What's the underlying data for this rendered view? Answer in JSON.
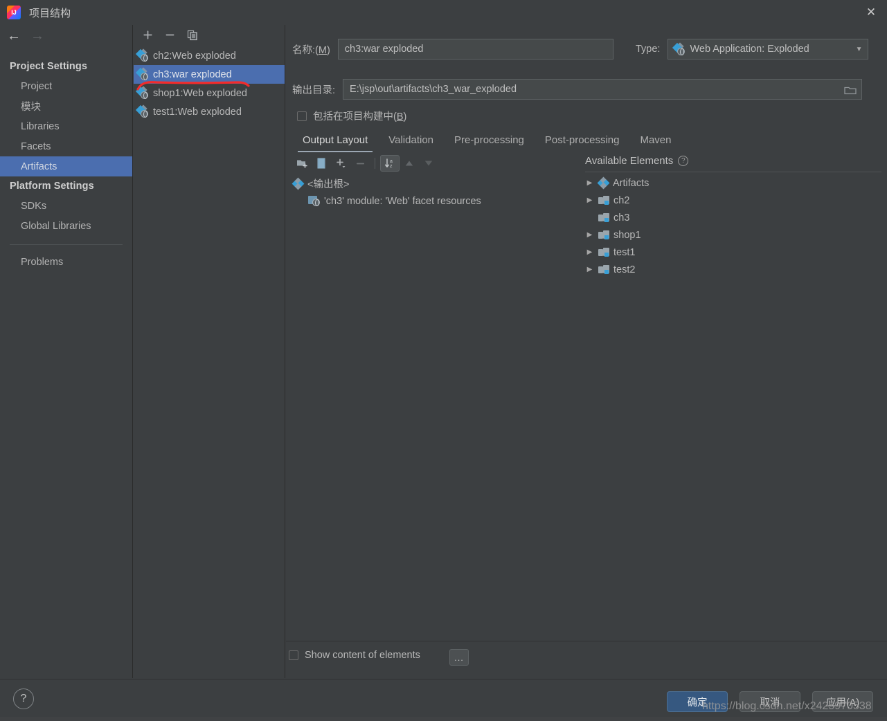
{
  "window": {
    "title": "项目结构",
    "app_icon": "intellij-idea-icon",
    "close_label": "✕"
  },
  "sidebar": {
    "back_label": "←",
    "forward_label": "→",
    "groups": [
      {
        "label": "Project Settings",
        "items": [
          {
            "label": "Project",
            "selected": false
          },
          {
            "label": "模块",
            "selected": false
          },
          {
            "label": "Libraries",
            "selected": false
          },
          {
            "label": "Facets",
            "selected": false
          },
          {
            "label": "Artifacts",
            "selected": true
          }
        ]
      },
      {
        "label": "Platform Settings",
        "items": [
          {
            "label": "SDKs",
            "selected": false
          },
          {
            "label": "Global Libraries",
            "selected": false
          }
        ]
      }
    ],
    "problems_label": "Problems"
  },
  "artifacts_panel": {
    "toolbar": [
      {
        "name": "add-artifact-button",
        "glyph": "+"
      },
      {
        "name": "remove-artifact-button",
        "glyph": "−"
      },
      {
        "name": "copy-artifact-button",
        "glyph": "copy-icon"
      }
    ],
    "items": [
      {
        "label": "ch2:Web exploded",
        "selected": false
      },
      {
        "label": "ch3:war exploded",
        "selected": true
      },
      {
        "label": "shop1:Web exploded",
        "selected": false
      },
      {
        "label": "test1:Web exploded",
        "selected": false
      }
    ]
  },
  "annotation": {
    "color": "#F42B2B",
    "type": "hand-drawn-underline"
  },
  "form": {
    "name_label": "名称:(M)",
    "name_mnemonic": "M",
    "name_value": "ch3:war exploded",
    "type_label": "Type:",
    "type_value": "Web Application: Exploded",
    "output_dir_label": "输出目录:",
    "output_dir_value": "E:\\jsp\\out\\artifacts\\ch3_war_exploded",
    "include_in_build_label": "包括在项目构建中(B)",
    "include_in_build_mnemonic": "B",
    "include_in_build_checked": false
  },
  "tabs": [
    {
      "label": "Output Layout",
      "active": true
    },
    {
      "label": "Validation",
      "active": false
    },
    {
      "label": "Pre-processing",
      "active": false
    },
    {
      "label": "Post-processing",
      "active": false
    },
    {
      "label": "Maven",
      "active": false
    }
  ],
  "layout_toolbar": [
    {
      "name": "create-directory-button",
      "icon": "folder-add-icon",
      "pressed": false,
      "enabled": true
    },
    {
      "name": "create-archive-button",
      "icon": "archive-icon",
      "pressed": false,
      "enabled": true
    },
    {
      "name": "add-copy-of-button",
      "icon": "plus-dropdown-icon",
      "pressed": false,
      "enabled": true
    },
    {
      "name": "remove-element-button",
      "icon": "minus-icon",
      "pressed": false,
      "enabled": false
    },
    {
      "name": "sort-elements-button",
      "icon": "sort-az-icon",
      "pressed": true,
      "enabled": true
    },
    {
      "name": "move-up-button",
      "icon": "arrow-up-icon",
      "pressed": false,
      "enabled": false
    },
    {
      "name": "move-down-button",
      "icon": "arrow-down-icon",
      "pressed": false,
      "enabled": false
    }
  ],
  "output_tree": [
    {
      "label": "<输出根>",
      "icon": "artifact-diamond-icon",
      "indent": 0,
      "twisty": ""
    },
    {
      "label": "'ch3' module: 'Web' facet resources",
      "icon": "facet-resources-icon",
      "indent": 1,
      "twisty": ""
    }
  ],
  "available_elements": {
    "title": "Available Elements",
    "help_glyph": "?",
    "items": [
      {
        "label": "Artifacts",
        "icon": "artifact-diamond-icon",
        "twisty": "▶"
      },
      {
        "label": "ch2",
        "icon": "module-icon",
        "twisty": "▶"
      },
      {
        "label": "ch3",
        "icon": "module-icon",
        "twisty": ""
      },
      {
        "label": "shop1",
        "icon": "module-icon",
        "twisty": "▶"
      },
      {
        "label": "test1",
        "icon": "module-icon",
        "twisty": "▶"
      },
      {
        "label": "test2",
        "icon": "module-icon",
        "twisty": "▶"
      }
    ]
  },
  "bottom_bar": {
    "show_content_label": "Show content of elements",
    "show_content_checked": false,
    "more_button_label": "..."
  },
  "footer": {
    "help_label": "?",
    "buttons": [
      {
        "label": "确定",
        "primary": true
      },
      {
        "label": "取消",
        "primary": false
      },
      {
        "label": "应用(A)",
        "primary": false
      }
    ]
  },
  "watermark": {
    "text": "https://blog.csdn.net/x2425970538"
  },
  "colors": {
    "background": "#3C3F41",
    "selection": "#4B6EAF",
    "primary_button": "#365880",
    "accent_blue": "#389FD6",
    "annotation_red": "#F42B2B"
  }
}
